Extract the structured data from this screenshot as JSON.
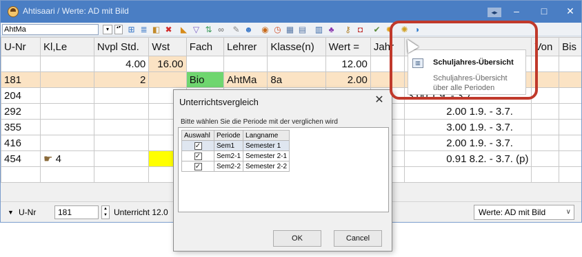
{
  "window": {
    "title": "Ahtisaari / Werte: AD mit Bild",
    "nav_label": "◂▸",
    "min_label": "–",
    "max_label": "□",
    "close_label": "✕"
  },
  "toolbar": {
    "combo_value": "AhtMa",
    "combo_arrow": "▾",
    "spin": "▴▾"
  },
  "grid": {
    "headers": [
      "U-Nr",
      "Kl,Le",
      "Nvpl Std.",
      "Wst",
      "Fach",
      "Lehrer",
      "Klasse(n)",
      "Wert =",
      "Jahr",
      "",
      "Von",
      "Bis"
    ],
    "totals": {
      "nvpl": "4.00",
      "wst": "16.00",
      "wert": "12.00"
    },
    "rows": [
      {
        "unr": "181",
        "nvpl": "2",
        "fach": "Bio",
        "lehrer": "AhtMa",
        "klasse": "8a",
        "wert": "2.00",
        "jahr": "",
        "zeit": "",
        "selected": true
      },
      {
        "unr": "204",
        "nvpl": "",
        "fach": "",
        "lehrer": "",
        "klasse": "",
        "wert": "",
        "jahr": "",
        "zeit": "3.00 1.9. - 3.7."
      },
      {
        "unr": "292",
        "nvpl": "",
        "fach": "",
        "lehrer": "",
        "klasse": "",
        "wert": "",
        "jahr": "",
        "zeit": "2.00 1.9. - 3.7."
      },
      {
        "unr": "355",
        "nvpl": "",
        "fach": "",
        "lehrer": "",
        "klasse": "",
        "wert": "",
        "jahr": "",
        "zeit": "3.00 1.9. - 3.7."
      },
      {
        "unr": "416",
        "nvpl": "",
        "fach": "",
        "lehrer": "",
        "klasse": "",
        "wert": "",
        "jahr": "",
        "zeit": "2.00 1.9. - 3.7."
      },
      {
        "unr": "454",
        "nvpl": "4",
        "fach": "",
        "lehrer": "",
        "klasse": "",
        "wert": "",
        "jahr": "",
        "zeit": "0.91 8.2. - 3.7. (p)"
      }
    ]
  },
  "statusbar": {
    "label": "U-Nr",
    "value": "181",
    "unterricht": "Unterricht 12.0",
    "select_value": "Werte: AD mit Bild",
    "select_arrow": "∨"
  },
  "dialog": {
    "title": "Unterrichtsvergleich",
    "close": "✕",
    "prompt": "Bitte wählen Sie die Periode mit der verglichen wird",
    "columns": [
      "Auswahl",
      "Periode",
      "Langname"
    ],
    "rows": [
      {
        "periode": "Sem1",
        "langname": "Semester 1",
        "checked": true
      },
      {
        "periode": "Sem2-1",
        "langname": "Semester 2-1",
        "checked": true
      },
      {
        "periode": "Sem2-2",
        "langname": "Semester 2-2",
        "checked": true
      }
    ],
    "check_mark": "✓",
    "ok": "OK",
    "cancel": "Cancel"
  },
  "tooltip": {
    "title": "Schuljahres-Übersicht",
    "description": "Schuljahres-Übersicht über alle Perioden"
  },
  "colors": {
    "titlebar": "#4a7ec4",
    "selected_row": "#fbe3c4",
    "fach_green": "#6fd66f",
    "highlight_yellow": "#ffff00",
    "annotation_red": "#c0392b"
  }
}
